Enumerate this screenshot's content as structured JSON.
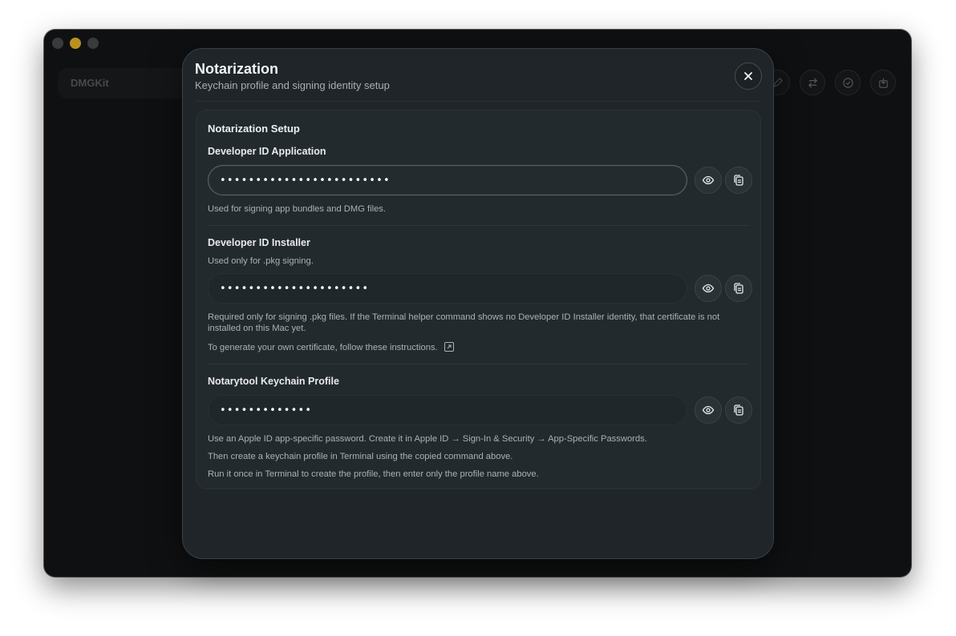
{
  "window": {
    "traffic_lights": [
      "close",
      "minimize",
      "maximize"
    ],
    "app_title": "DMGKit",
    "toolbar_icons": [
      "sign-icon",
      "swap-icon",
      "verify-badge-icon",
      "export-icon"
    ]
  },
  "sheet": {
    "title": "Notarization",
    "subtitle": "Keychain profile and signing identity setup",
    "close_icon": "close-icon"
  },
  "setup": {
    "title": "Notarization Setup",
    "developer_id_application": {
      "label": "Developer ID Application",
      "value": "••••••••••••••••••••••••",
      "help": "Used for signing app bundles and DMG files."
    },
    "developer_id_installer": {
      "label": "Developer ID Installer",
      "note": "Used only for .pkg signing.",
      "value": "•••••••••••••••••••••",
      "help": "Required only for signing .pkg files. If the Terminal helper command shows no Developer ID Installer identity, that certificate is not installed on this Mac yet.",
      "instructions": "To generate your own certificate, follow these instructions."
    },
    "notarytool_profile": {
      "label": "Notarytool Keychain Profile",
      "value": "•••••••••••••",
      "help_1": "Use an Apple ID app-specific password. Create it in Apple ID → Sign-In & Security → App-Specific Passwords.",
      "help_2": "Then create a keychain profile in Terminal using the copied command above.",
      "help_3": "Run it once in Terminal to create the profile, then enter only the profile name above."
    },
    "action_icons": [
      "eye-icon",
      "copy-icon"
    ]
  },
  "colors": {
    "minimize": "#f7c22e",
    "sheet_bg": "#1f2528",
    "card_bg": "#232a2e",
    "text_primary": "#f1f3f4",
    "text_secondary": "#aab1b5"
  }
}
